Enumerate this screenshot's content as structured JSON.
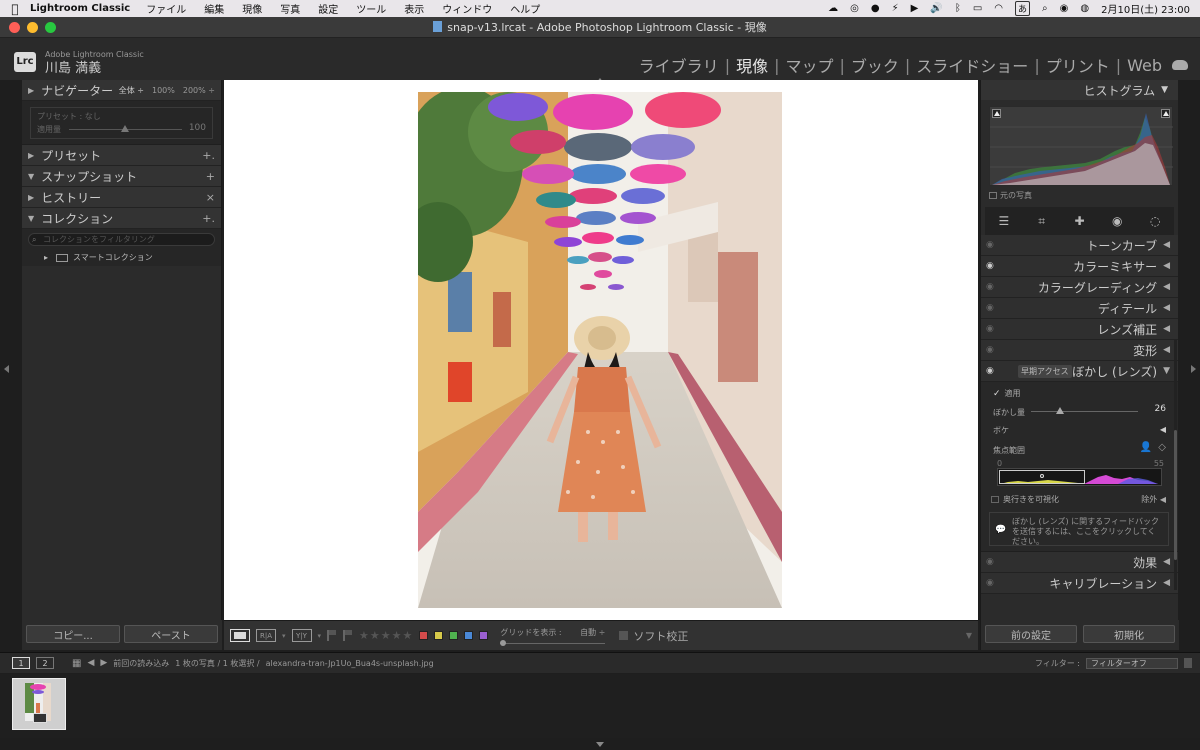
{
  "menubar": {
    "app_name": "Lightroom Classic",
    "items": [
      "ファイル",
      "編集",
      "現像",
      "写真",
      "設定",
      "ツール",
      "表示",
      "ウィンドウ",
      "ヘルプ"
    ],
    "input_indicator": "あ",
    "clock": "2月10日(土)  23:00"
  },
  "window": {
    "title": "snap-v13.lrcat - Adobe Photoshop Lightroom Classic - 現像"
  },
  "identity": {
    "product": "Adobe Lightroom Classic",
    "user": "川島 満義",
    "badge": "Lrc"
  },
  "modules": {
    "items": [
      {
        "label": "ライブラリ",
        "active": false
      },
      {
        "label": "現像",
        "active": true
      },
      {
        "label": "マップ",
        "active": false
      },
      {
        "label": "ブック",
        "active": false
      },
      {
        "label": "スライドショー",
        "active": false
      },
      {
        "label": "プリント",
        "active": false
      },
      {
        "label": "Web",
        "active": false
      }
    ],
    "separator": "|"
  },
  "left_panel": {
    "navigator": {
      "title": "ナビゲーター",
      "zoom_fit": "全体 ÷",
      "zoom_100": "100%",
      "zoom_200": "200% ÷"
    },
    "preset_preview": {
      "label": "プリセット : なし",
      "amount_label": "適用量",
      "amount_value": "100"
    },
    "presets": {
      "title": "プリセット",
      "ctrl": "+."
    },
    "snapshots": {
      "title": "スナップショット",
      "ctrl": "+"
    },
    "history": {
      "title": "ヒストリー",
      "ctrl": "×"
    },
    "collections": {
      "title": "コレクション",
      "ctrl": "+.",
      "filter_placeholder": "コレクションをフィルタリング",
      "smart_collection": "スマートコレクション"
    },
    "copy_button": "コピー...",
    "paste_button": "ペースト"
  },
  "toolbar": {
    "grid_label": "グリッドを表示 :",
    "grid_mode": "自動 ÷",
    "soft_proof": "ソフト校正",
    "stars": "★★★★★",
    "label_colors": [
      "#d34b4b",
      "#d6c94a",
      "#4fb14f",
      "#4a88d6",
      "#9a5fd0"
    ],
    "before_after_1": "R|A",
    "before_after_2": "Y|Y"
  },
  "right_panel": {
    "histogram_title": "ヒストグラム",
    "original_photo": "元の写真",
    "sections": [
      {
        "label": "トーンカーブ",
        "eye": false
      },
      {
        "label": "カラーミキサー",
        "eye": true
      },
      {
        "label": "カラーグレーディング",
        "eye": false
      },
      {
        "label": "ディテール",
        "eye": false
      },
      {
        "label": "レンズ補正",
        "eye": false
      },
      {
        "label": "変形",
        "eye": false
      }
    ],
    "lens_blur": {
      "title": "ぼかし (レンズ)",
      "early_access": "早期アクセス",
      "apply": "適用",
      "amount_label": "ぼかし量",
      "amount_value": "26",
      "amount_fraction": 0.26,
      "bokeh": "ボケ",
      "focus_range": "焦点範囲",
      "range_min": "0",
      "range_max": "55",
      "visualize": "奥行きを可視化",
      "exclude": "除外",
      "feedback": "ぼかし (レンズ) に関するフィードバックを送信するには、ここをクリックしてください。"
    },
    "bottom_sections": [
      {
        "label": "効果",
        "eye": false
      },
      {
        "label": "キャリブレーション",
        "eye": false
      }
    ],
    "previous_button": "前の設定",
    "reset_button": "初期化"
  },
  "filmstrip": {
    "page1": "1",
    "page2": "2",
    "source": "前回の読み込み",
    "count": "1 枚の写真 / 1 枚選択 /",
    "filename": "alexandra-tran-Jp1Uo_Bua4s-unsplash.jpg",
    "filter_label": "フィルター :",
    "filter_value": "フィルターオフ"
  }
}
